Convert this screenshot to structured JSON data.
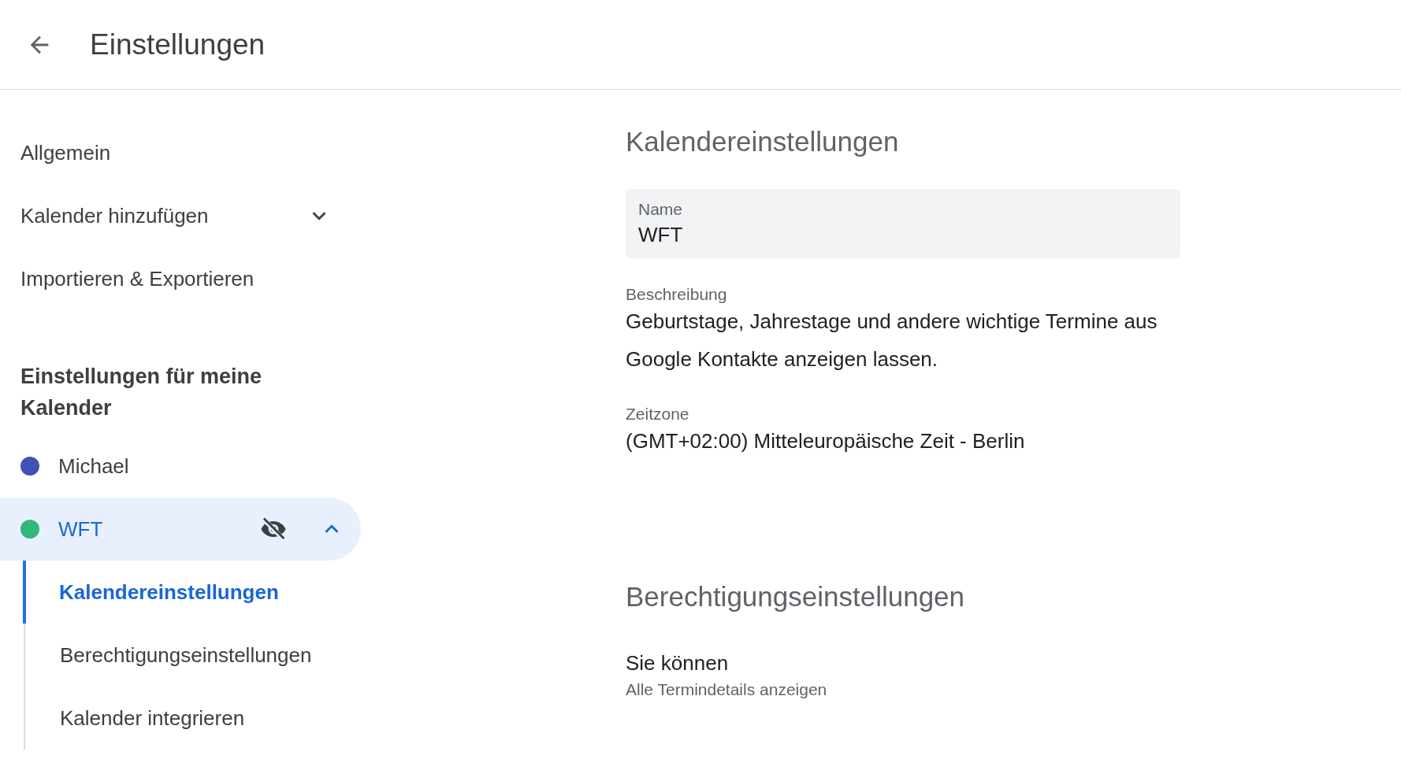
{
  "header": {
    "title": "Einstellungen"
  },
  "sidebar": {
    "items": [
      {
        "label": "Allgemein",
        "kind": "link"
      },
      {
        "label": "Kalender hinzufügen",
        "kind": "expandable",
        "expanded": false
      },
      {
        "label": "Importieren & Exportieren",
        "kind": "link"
      }
    ],
    "my_calendars": {
      "heading": "Einstellungen für meine Kalender",
      "calendars": [
        {
          "name": "Michael",
          "color": "#3f51b5",
          "selected": false
        },
        {
          "name": "WFT",
          "color": "#33b679",
          "selected": true,
          "expanded": true,
          "hidden": true,
          "children": [
            {
              "label": "Kalendereinstellungen",
              "selected": true
            },
            {
              "label": "Berechtigungseinstellungen",
              "selected": false
            },
            {
              "label": "Kalender integrieren",
              "selected": false
            }
          ]
        }
      ]
    }
  },
  "sections": [
    {
      "title": "Kalendereinstellungen",
      "fields": [
        {
          "kind": "input",
          "label": "Name",
          "value": "WFT"
        },
        {
          "kind": "text",
          "label": "Beschreibung",
          "value": "Geburtstage, Jahrestage und andere wichtige Termine aus Google Kontakte anzeigen lassen."
        },
        {
          "kind": "text",
          "label": "Zeitzone",
          "value": "(GMT+02:00) Mitteleuropäische Zeit - Berlin"
        }
      ]
    },
    {
      "title": "Berechtigungseinstellungen",
      "fields": [
        {
          "kind": "permission",
          "label": "Sie können",
          "value": "Alle Termindetails anzeigen"
        }
      ]
    }
  ]
}
